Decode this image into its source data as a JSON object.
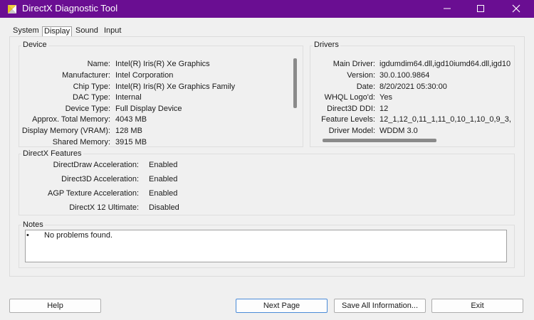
{
  "window": {
    "title": "DirectX Diagnostic Tool",
    "title_bar_color": "#6a0e92"
  },
  "tabs": [
    {
      "label": "System"
    },
    {
      "label": "Display",
      "active": true
    },
    {
      "label": "Sound"
    },
    {
      "label": "Input"
    }
  ],
  "device": {
    "title": "Device",
    "fields": [
      {
        "label": "Name:",
        "value": "Intel(R) Iris(R) Xe Graphics"
      },
      {
        "label": "Manufacturer:",
        "value": "Intel Corporation"
      },
      {
        "label": "Chip Type:",
        "value": "Intel(R) Iris(R) Xe Graphics Family"
      },
      {
        "label": "DAC Type:",
        "value": "Internal"
      },
      {
        "label": "Device Type:",
        "value": "Full Display Device"
      },
      {
        "label": "Approx. Total Memory:",
        "value": "4043 MB"
      },
      {
        "label": "Display Memory (VRAM):",
        "value": "128 MB"
      },
      {
        "label": "Shared Memory:",
        "value": "3915 MB"
      }
    ]
  },
  "drivers": {
    "title": "Drivers",
    "fields": [
      {
        "label": "Main Driver:",
        "value": "igdumdim64.dll,igd10iumd64.dll,igd10"
      },
      {
        "label": "Version:",
        "value": "30.0.100.9864"
      },
      {
        "label": "Date:",
        "value": "8/20/2021 05:30:00"
      },
      {
        "label": "WHQL Logo'd:",
        "value": "Yes"
      },
      {
        "label": "Direct3D DDI:",
        "value": "12"
      },
      {
        "label": "Feature Levels:",
        "value": "12_1,12_0,11_1,11_0,10_1,10_0,9_3,"
      },
      {
        "label": "Driver Model:",
        "value": "WDDM 3.0"
      }
    ]
  },
  "features": {
    "title": "DirectX Features",
    "fields": [
      {
        "label": "DirectDraw Acceleration:",
        "value": "Enabled"
      },
      {
        "label": "Direct3D Acceleration:",
        "value": "Enabled"
      },
      {
        "label": "AGP Texture Acceleration:",
        "value": "Enabled"
      },
      {
        "label": "DirectX 12 Ultimate:",
        "value": "Disabled"
      }
    ]
  },
  "notes": {
    "title": "Notes",
    "bullet": "•",
    "text": "No problems found."
  },
  "buttons": {
    "help": "Help",
    "next_page": "Next Page",
    "save_all": "Save All Information...",
    "exit": "Exit"
  }
}
